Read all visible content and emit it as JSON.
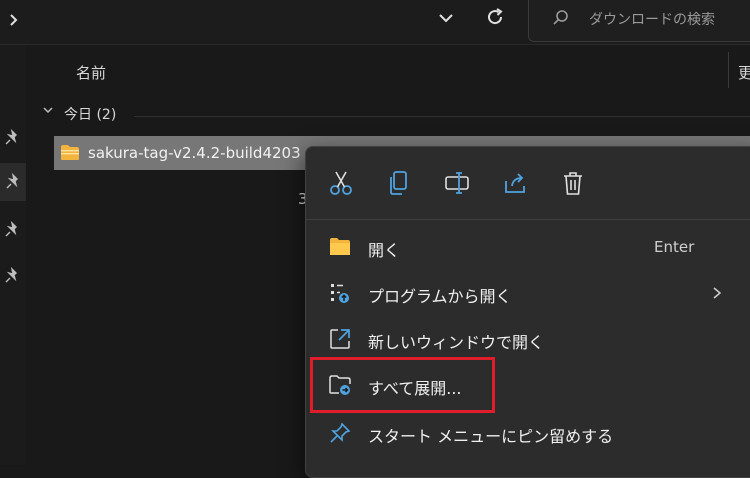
{
  "search": {
    "placeholder": "ダウンロードの検索"
  },
  "columns": {
    "name": "名前",
    "next": "更"
  },
  "group": {
    "label": "今日 (2)"
  },
  "file": {
    "name": "sakura-tag-v2.4.2-build4203"
  },
  "second_row": {
    "partial": "3"
  },
  "context_menu": {
    "quick_actions": [
      "cut-icon",
      "copy-icon",
      "rename-icon",
      "share-icon",
      "delete-icon"
    ],
    "items": [
      {
        "icon": "folder-icon",
        "label": "開く",
        "shortcut": "Enter"
      },
      {
        "icon": "open-with-icon",
        "label": "プログラムから開く",
        "submenu": true
      },
      {
        "icon": "new-window-icon",
        "label": "新しいウィンドウで開く"
      },
      {
        "icon": "extract-icon",
        "label": "すべて展開..."
      },
      {
        "icon": "pin-icon",
        "label": "スタート メニューにピン留めする"
      }
    ]
  },
  "colors": {
    "accent": "#4fa3e0",
    "highlight_box": "#e01e2b",
    "folder": "#f2b43c"
  }
}
